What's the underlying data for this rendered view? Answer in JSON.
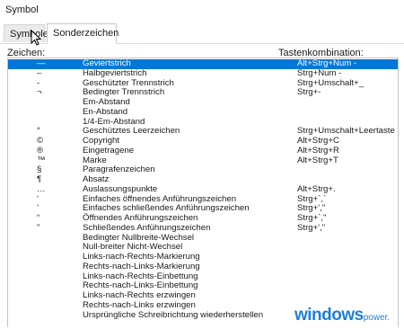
{
  "window": {
    "title": "Symbol"
  },
  "tabs": [
    {
      "label": "Symbole"
    },
    {
      "label": "Sonderzeichen"
    }
  ],
  "columns": {
    "chars": "Zeichen:",
    "shortcut": "Tastenkombination:"
  },
  "rows": [
    {
      "char": "—",
      "name": "Geviertstrich",
      "shortcut": "Alt+Strg+Num -",
      "selected": true
    },
    {
      "char": "–",
      "name": "Halbgeviertstrich",
      "shortcut": "Strg+Num -"
    },
    {
      "char": "‑",
      "name": "Geschützter Trennstrich",
      "shortcut": "Strg+Umschalt+_"
    },
    {
      "char": "¬",
      "name": "Bedingter Trennstrich",
      "shortcut": "Strg+-"
    },
    {
      "char": "",
      "name": "Em-Abstand",
      "shortcut": ""
    },
    {
      "char": "",
      "name": "En-Abstand",
      "shortcut": ""
    },
    {
      "char": "",
      "name": "1/4-Em-Abstand",
      "shortcut": ""
    },
    {
      "char": "°",
      "name": "Geschütztes Leerzeichen",
      "shortcut": "Strg+Umschalt+Leertaste"
    },
    {
      "char": "©",
      "name": "Copyright",
      "shortcut": "Alt+Strg+C"
    },
    {
      "char": "®",
      "name": "Eingetragene",
      "shortcut": "Alt+Strg+R"
    },
    {
      "char": "™",
      "name": "Marke",
      "shortcut": "Alt+Strg+T"
    },
    {
      "char": "§",
      "name": "Paragrafenzeichen",
      "shortcut": ""
    },
    {
      "char": "¶",
      "name": "Absatz",
      "shortcut": ""
    },
    {
      "char": "…",
      "name": "Auslassungspunkte",
      "shortcut": "Alt+Strg+."
    },
    {
      "char": "‘",
      "name": "Einfaches öffnendes Anführungszeichen",
      "shortcut": "Strg+`,`"
    },
    {
      "char": "’",
      "name": "Einfaches schließendes Anführungszeichen",
      "shortcut": "Strg+',''"
    },
    {
      "char": "“",
      "name": "Öffnendes Anführungszeichen",
      "shortcut": "Strg+`,\""
    },
    {
      "char": "”",
      "name": "Schließendes Anführungszeichen",
      "shortcut": "Strg+',\""
    },
    {
      "char": "",
      "name": "Bedingter Nullbreite-Wechsel",
      "shortcut": ""
    },
    {
      "char": "",
      "name": "Null-breiter Nicht-Wechsel",
      "shortcut": ""
    },
    {
      "char": "",
      "name": "Links-nach-Rechts-Markierung",
      "shortcut": ""
    },
    {
      "char": "",
      "name": "Rechts-nach-Links-Markierung",
      "shortcut": ""
    },
    {
      "char": "",
      "name": "Links-nach-Rechts-Einbettung",
      "shortcut": ""
    },
    {
      "char": "",
      "name": "Rechts-nach-Links-Einbettung",
      "shortcut": ""
    },
    {
      "char": "",
      "name": "Links-nach-Rechts erzwingen",
      "shortcut": ""
    },
    {
      "char": "",
      "name": "Rechts-nach-Links erzwingen",
      "shortcut": ""
    },
    {
      "char": "",
      "name": "Ursprüngliche Schreibrichtung wiederherstellen",
      "shortcut": ""
    }
  ],
  "watermark": {
    "brand": "windows",
    "suffix": "power."
  },
  "colors": {
    "selection": "#0078d7",
    "brand": "#1e7fd9"
  }
}
